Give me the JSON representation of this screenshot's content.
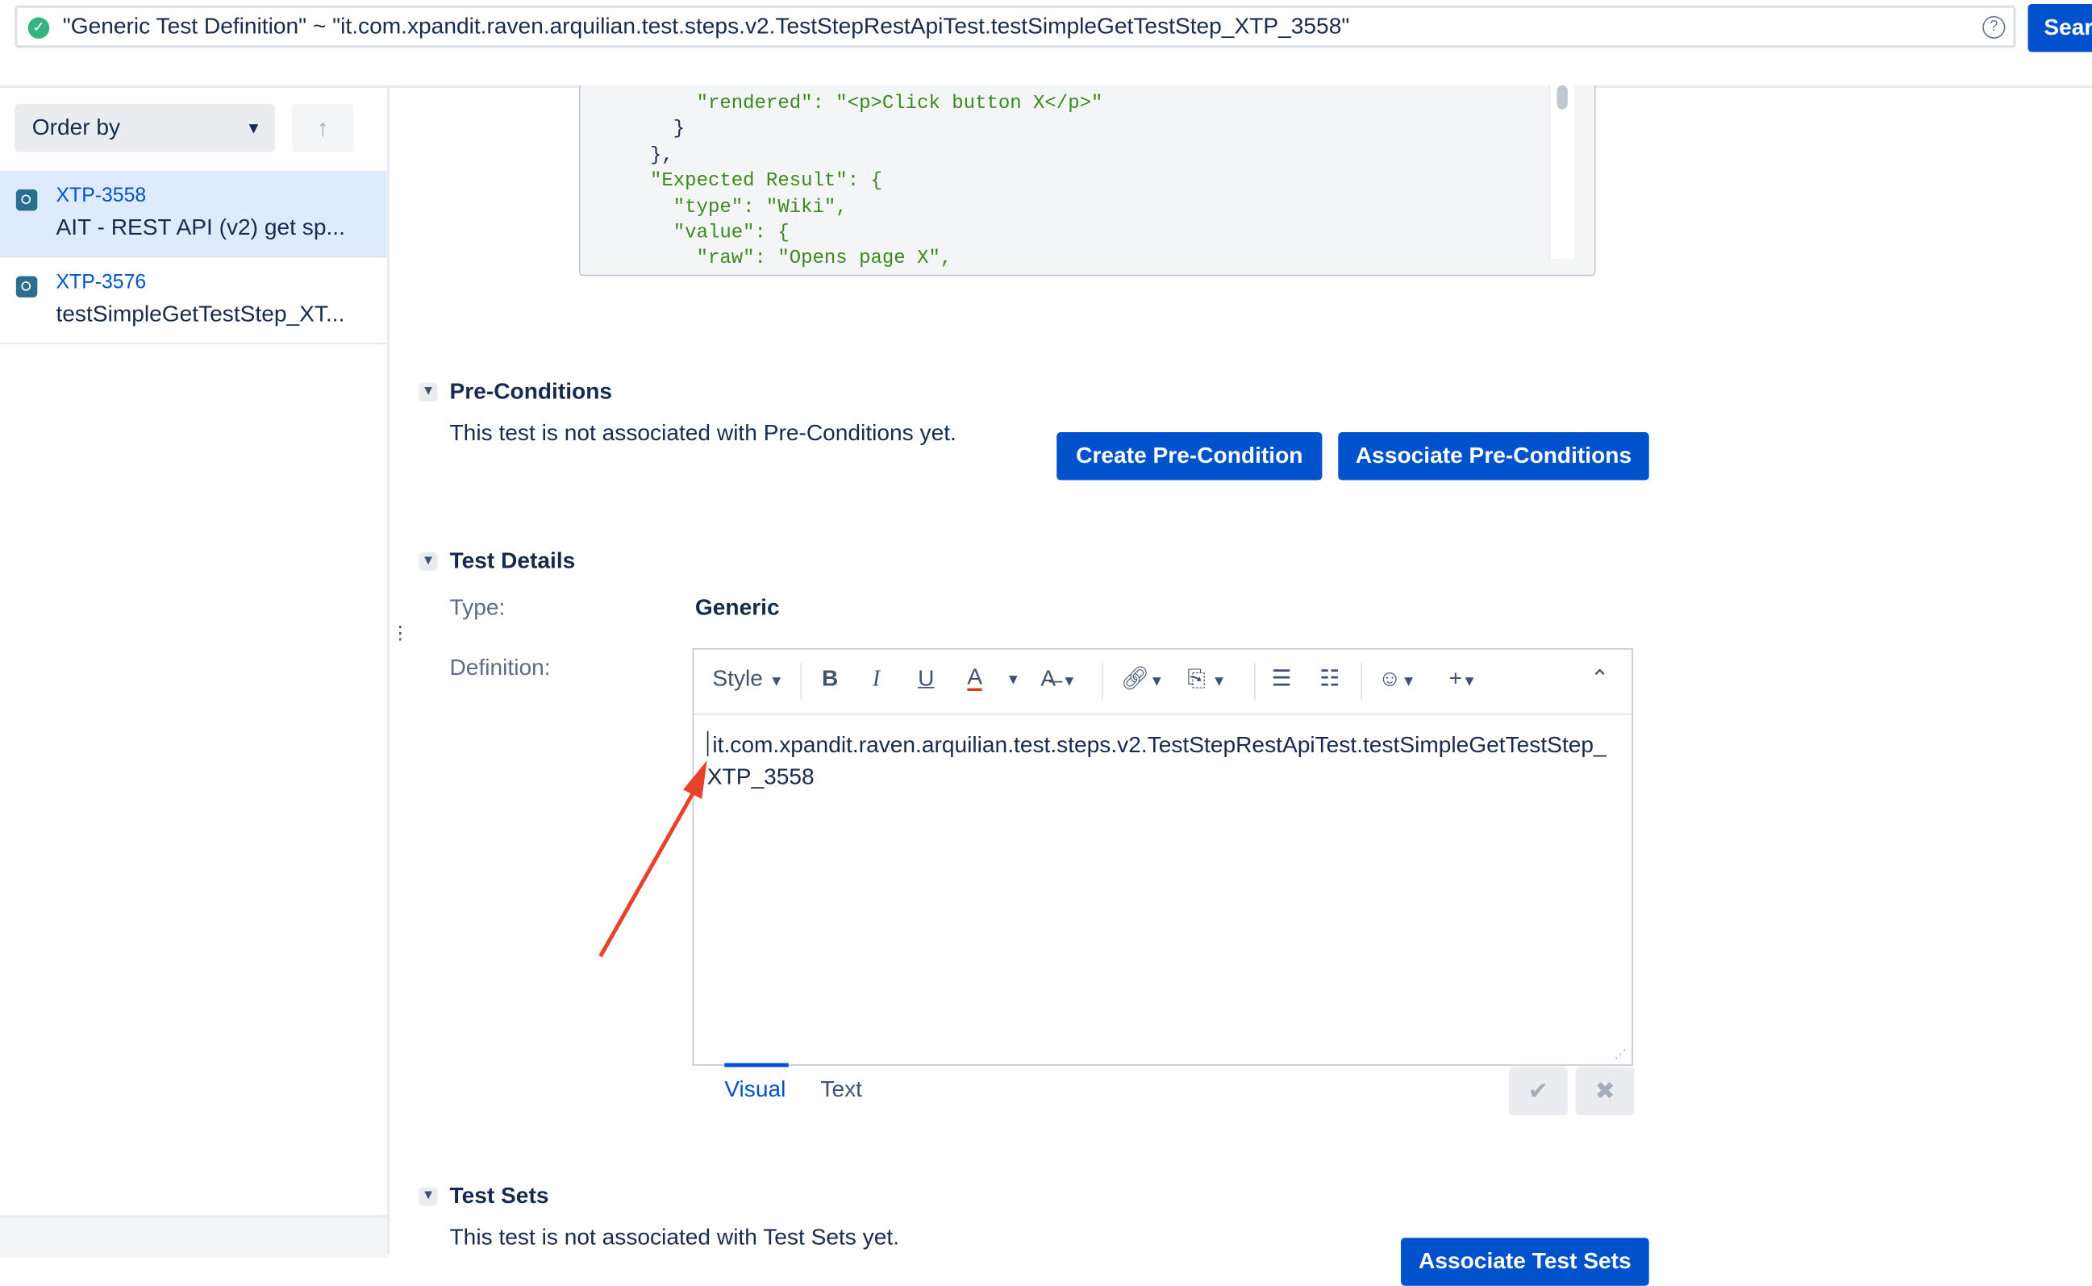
{
  "search": {
    "query": "\"Generic Test Definition\" ~ \"it.com.xpandit.raven.arquilian.test.steps.v2.TestStepRestApiTest.testSimpleGetTestStep_XTP_3558\"",
    "button": "Search",
    "help": "?"
  },
  "sidebar": {
    "order_by": "Order by",
    "items": [
      {
        "key": "XTP-3558",
        "summary": "AIT - REST API (v2) get sp..."
      },
      {
        "key": "XTP-3576",
        "summary": "testSimpleGetTestStep_XT..."
      }
    ]
  },
  "code_lines": [
    "          \"rendered\": \"<p>Click button X</p>\"",
    "        }",
    "      },",
    "      \"Expected Result\": {",
    "        \"type\": \"Wiki\",",
    "        \"value\": {",
    "          \"raw\": \"Opens page X\","
  ],
  "preconditions": {
    "title": "Pre-Conditions",
    "message": "This test is not associated with Pre-Conditions yet.",
    "create": "Create Pre-Condition",
    "associate": "Associate Pre-Conditions"
  },
  "details": {
    "title": "Test Details",
    "type_label": "Type:",
    "type_value": "Generic",
    "definition_label": "Definition:",
    "style": "Style",
    "definition_text": "it.com.xpandit.raven.arquilian.test.steps.v2.TestStepRestApiTest.testSimpleGetTestStep_XTP_3558",
    "tab_visual": "Visual",
    "tab_text": "Text"
  },
  "testsets": {
    "title": "Test Sets",
    "message": "This test is not associated with Test Sets yet.",
    "associate": "Associate Test Sets"
  },
  "colors": {
    "primary": "#0052cc",
    "annotation_arrow": "#e8412c"
  }
}
